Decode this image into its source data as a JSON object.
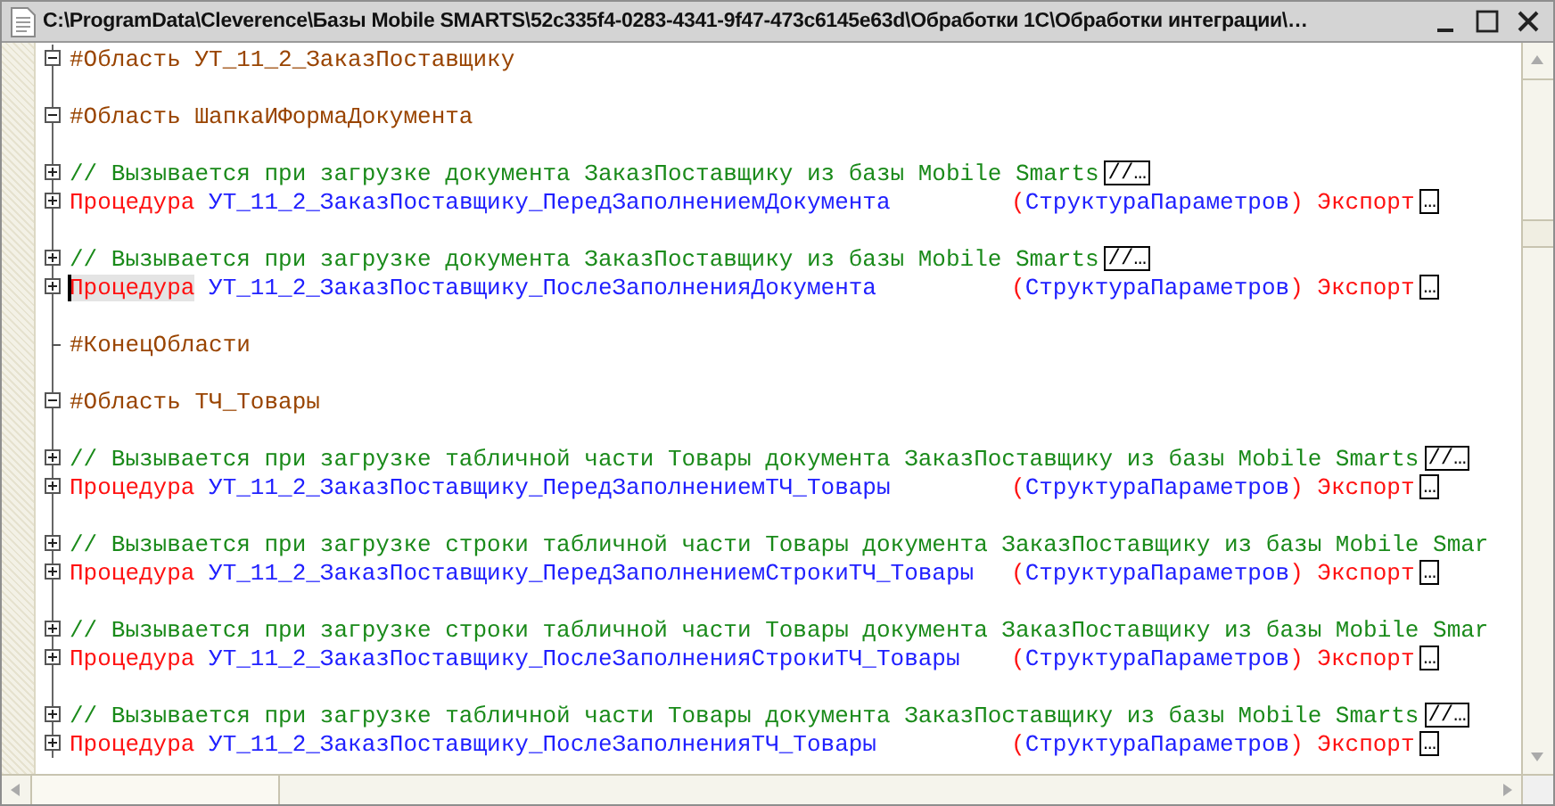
{
  "window": {
    "title": "C:\\ProgramData\\Cleverence\\Базы Mobile SMARTS\\52c335f4-0283-4341-9f47-473c6145e63d\\Обработки 1С\\Обработки интеграции\\…"
  },
  "lines": [
    {
      "kind": "region",
      "expanded": true,
      "text": "#Область УТ_11_2_ЗаказПоставщику"
    },
    {
      "kind": "blank"
    },
    {
      "kind": "region",
      "expanded": true,
      "text": "#Область ШапкаИФормаДокумента"
    },
    {
      "kind": "blank"
    },
    {
      "kind": "comment",
      "expanded": false,
      "text": "// Вызывается при загрузке документа ЗаказПоставщику из базы Mobile Smarts",
      "collapsed": "//…"
    },
    {
      "kind": "procedure",
      "expanded": false,
      "current": false,
      "keyword": "Процедура",
      "name": "УТ_11_2_ЗаказПоставщику_ПередЗаполнениемДокумента",
      "open": "(",
      "params": "СтруктураПараметров",
      "close": ")",
      "export": "Экспорт",
      "collapsed": "…"
    },
    {
      "kind": "blank"
    },
    {
      "kind": "comment",
      "expanded": false,
      "text": "// Вызывается при загрузке документа ЗаказПоставщику из базы Mobile Smarts",
      "collapsed": "//…"
    },
    {
      "kind": "procedure",
      "expanded": false,
      "current": true,
      "keyword": "Процедура",
      "name": "УТ_11_2_ЗаказПоставщику_ПослеЗаполненияДокумента",
      "open": "(",
      "params": "СтруктураПараметров",
      "close": ")",
      "export": "Экспорт",
      "collapsed": "…"
    },
    {
      "kind": "blank"
    },
    {
      "kind": "region_end",
      "text": "#КонецОбласти"
    },
    {
      "kind": "blank"
    },
    {
      "kind": "region",
      "expanded": true,
      "text": "#Область ТЧ_Товары"
    },
    {
      "kind": "blank"
    },
    {
      "kind": "comment",
      "expanded": false,
      "text": "// Вызывается при загрузке табличной части Товары документа ЗаказПоставщику из базы Mobile Smarts",
      "collapsed": "//…"
    },
    {
      "kind": "procedure",
      "expanded": false,
      "current": false,
      "keyword": "Процедура",
      "name": "УТ_11_2_ЗаказПоставщику_ПередЗаполнениемТЧ_Товары",
      "open": "(",
      "params": "СтруктураПараметров",
      "close": ")",
      "export": "Экспорт",
      "collapsed": "…"
    },
    {
      "kind": "blank"
    },
    {
      "kind": "comment",
      "expanded": false,
      "text": "// Вызывается при загрузке строки табличной части Товары документа ЗаказПоставщику из базы Mobile Smar"
    },
    {
      "kind": "procedure",
      "expanded": false,
      "current": false,
      "keyword": "Процедура",
      "name": "УТ_11_2_ЗаказПоставщику_ПередЗаполнениемСтрокиТЧ_Товары",
      "open": "(",
      "params": "СтруктураПараметров",
      "close": ")",
      "export": "Экспорт",
      "collapsed": "…"
    },
    {
      "kind": "blank"
    },
    {
      "kind": "comment",
      "expanded": false,
      "text": "// Вызывается при загрузке строки табличной части Товары документа ЗаказПоставщику из базы Mobile Smar"
    },
    {
      "kind": "procedure",
      "expanded": false,
      "current": false,
      "keyword": "Процедура",
      "name": "УТ_11_2_ЗаказПоставщику_ПослеЗаполненияСтрокиТЧ_Товары",
      "open": "(",
      "params": "СтруктураПараметров",
      "close": ")",
      "export": "Экспорт",
      "collapsed": "…"
    },
    {
      "kind": "blank"
    },
    {
      "kind": "comment",
      "expanded": false,
      "text": "// Вызывается при загрузке табличной части Товары документа ЗаказПоставщику из базы Mobile Smarts",
      "collapsed": "//…"
    },
    {
      "kind": "procedure",
      "expanded": false,
      "current": false,
      "keyword": "Процедура",
      "name": "УТ_11_2_ЗаказПоставщику_ПослеЗаполненияТЧ_Товары",
      "open": "(",
      "params": "СтруктураПараметров",
      "close": ")",
      "export": "Экспорт",
      "collapsed": "…"
    }
  ]
}
